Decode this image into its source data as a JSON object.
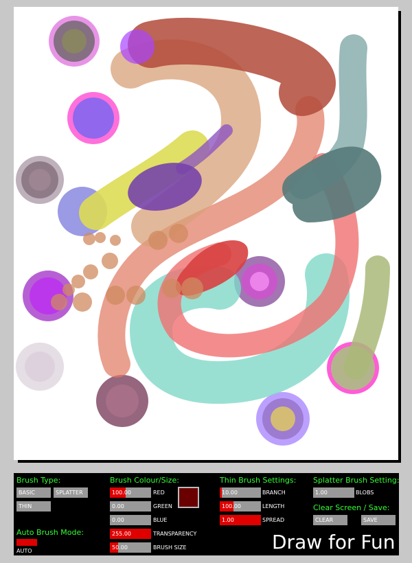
{
  "brush_type": {
    "header": "Brush Type:",
    "basic": "BASIC",
    "splatter": "SPLATTER",
    "thin": "THIN"
  },
  "auto_mode": {
    "header": "Auto Brush Mode:",
    "label": "AUTO",
    "enabled": true
  },
  "colour": {
    "header": "Brush Colour/Size:",
    "red": {
      "value": "100.00",
      "label": "RED",
      "fraction": 0.39
    },
    "green": {
      "value": "0.00",
      "label": "GREEN",
      "fraction": 0
    },
    "blue": {
      "value": "0.00",
      "label": "BLUE",
      "fraction": 0
    },
    "transparency": {
      "value": "255.00",
      "label": "TRANSPARENCY",
      "fraction": 1.0
    },
    "size": {
      "value": "50.00",
      "label": "BRUSH SIZE",
      "fraction": 0.2
    },
    "swatch_color": "#6b0000"
  },
  "thin": {
    "header": "Thin Brush Settings:",
    "branch": {
      "value": "10.00",
      "label": "BRANCH",
      "fraction": 0.05
    },
    "length": {
      "value": "100.00",
      "label": "LENGTH",
      "fraction": 0.33
    },
    "spread": {
      "value": "1.00",
      "label": "SPREAD",
      "fraction": 1.0
    }
  },
  "splatter": {
    "header": "Splatter Brush Setting:",
    "blobs": {
      "value": "1.00",
      "label": "BLOBS",
      "fraction": 0
    }
  },
  "clear_save": {
    "header": "Clear Screen / Save:",
    "clear": "CLEAR",
    "save": "SAVE"
  },
  "brand": "Draw for Fun",
  "accent_color": "#33ff33",
  "slider_fill_color": "#e00000"
}
